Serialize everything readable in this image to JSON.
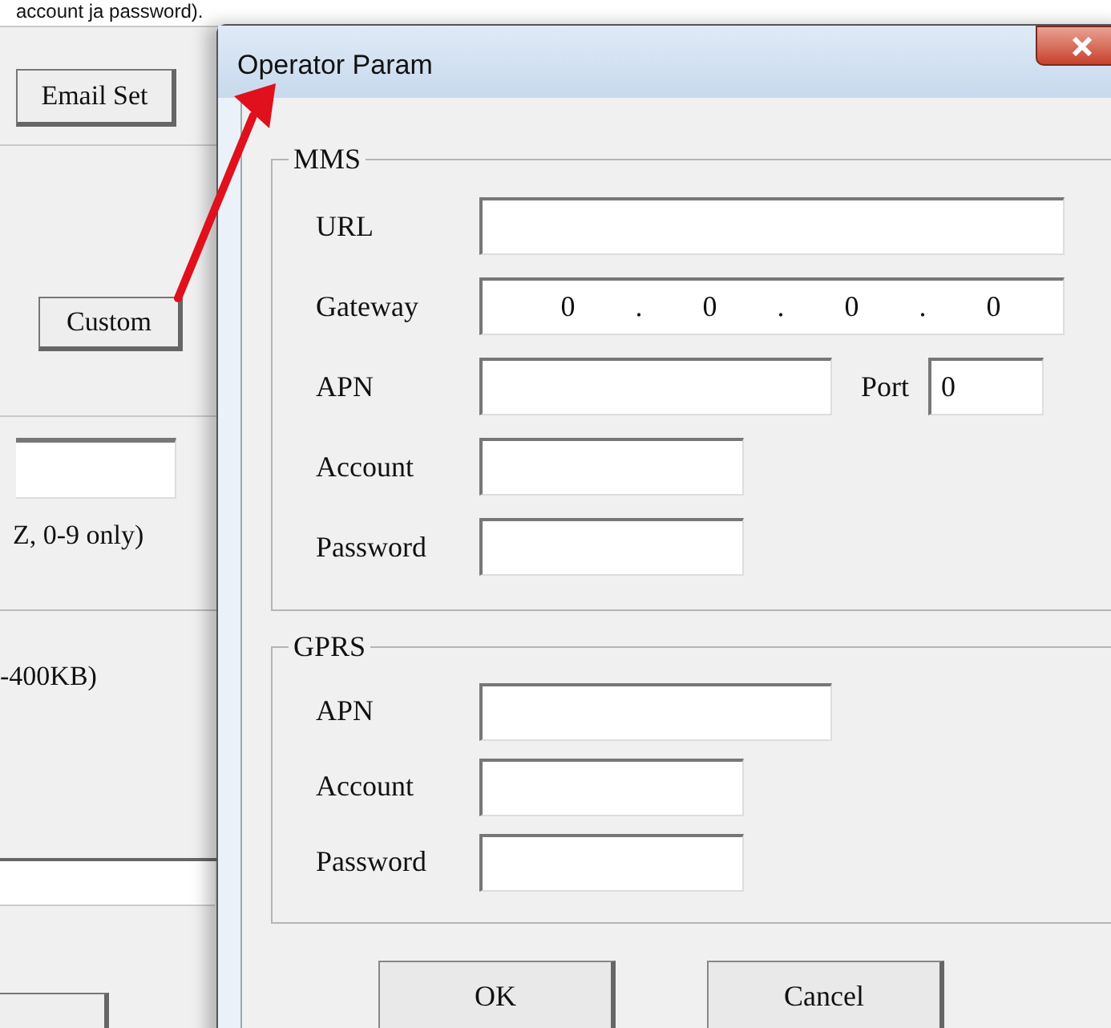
{
  "caption": "account ja password).",
  "background_window": {
    "buttons": [
      {
        "label": "Email Set"
      },
      {
        "label": "Custom"
      }
    ],
    "hints": [
      "Z, 0-9 only)",
      "-400KB)"
    ]
  },
  "dialog": {
    "title": "Operator Param",
    "groups": [
      {
        "title": "MMS",
        "fields": [
          {
            "label": "URL",
            "kind": "url"
          },
          {
            "label": "Gateway",
            "kind": "ip",
            "parts": [
              "0",
              ".",
              "0",
              ".",
              "0",
              ".",
              "0"
            ]
          },
          {
            "label": "APN",
            "kind": "apn",
            "port": {
              "label": "Port",
              "value": "0"
            }
          },
          {
            "label": "Account",
            "kind": "credential"
          },
          {
            "label": "Password",
            "kind": "credential"
          }
        ]
      },
      {
        "title": "GPRS",
        "fields": [
          {
            "label": "APN",
            "kind": "apn"
          },
          {
            "label": "Account",
            "kind": "credential"
          },
          {
            "label": "Password",
            "kind": "credential"
          }
        ]
      }
    ],
    "buttons": [
      {
        "label": "OK"
      },
      {
        "label": "Cancel"
      }
    ]
  }
}
